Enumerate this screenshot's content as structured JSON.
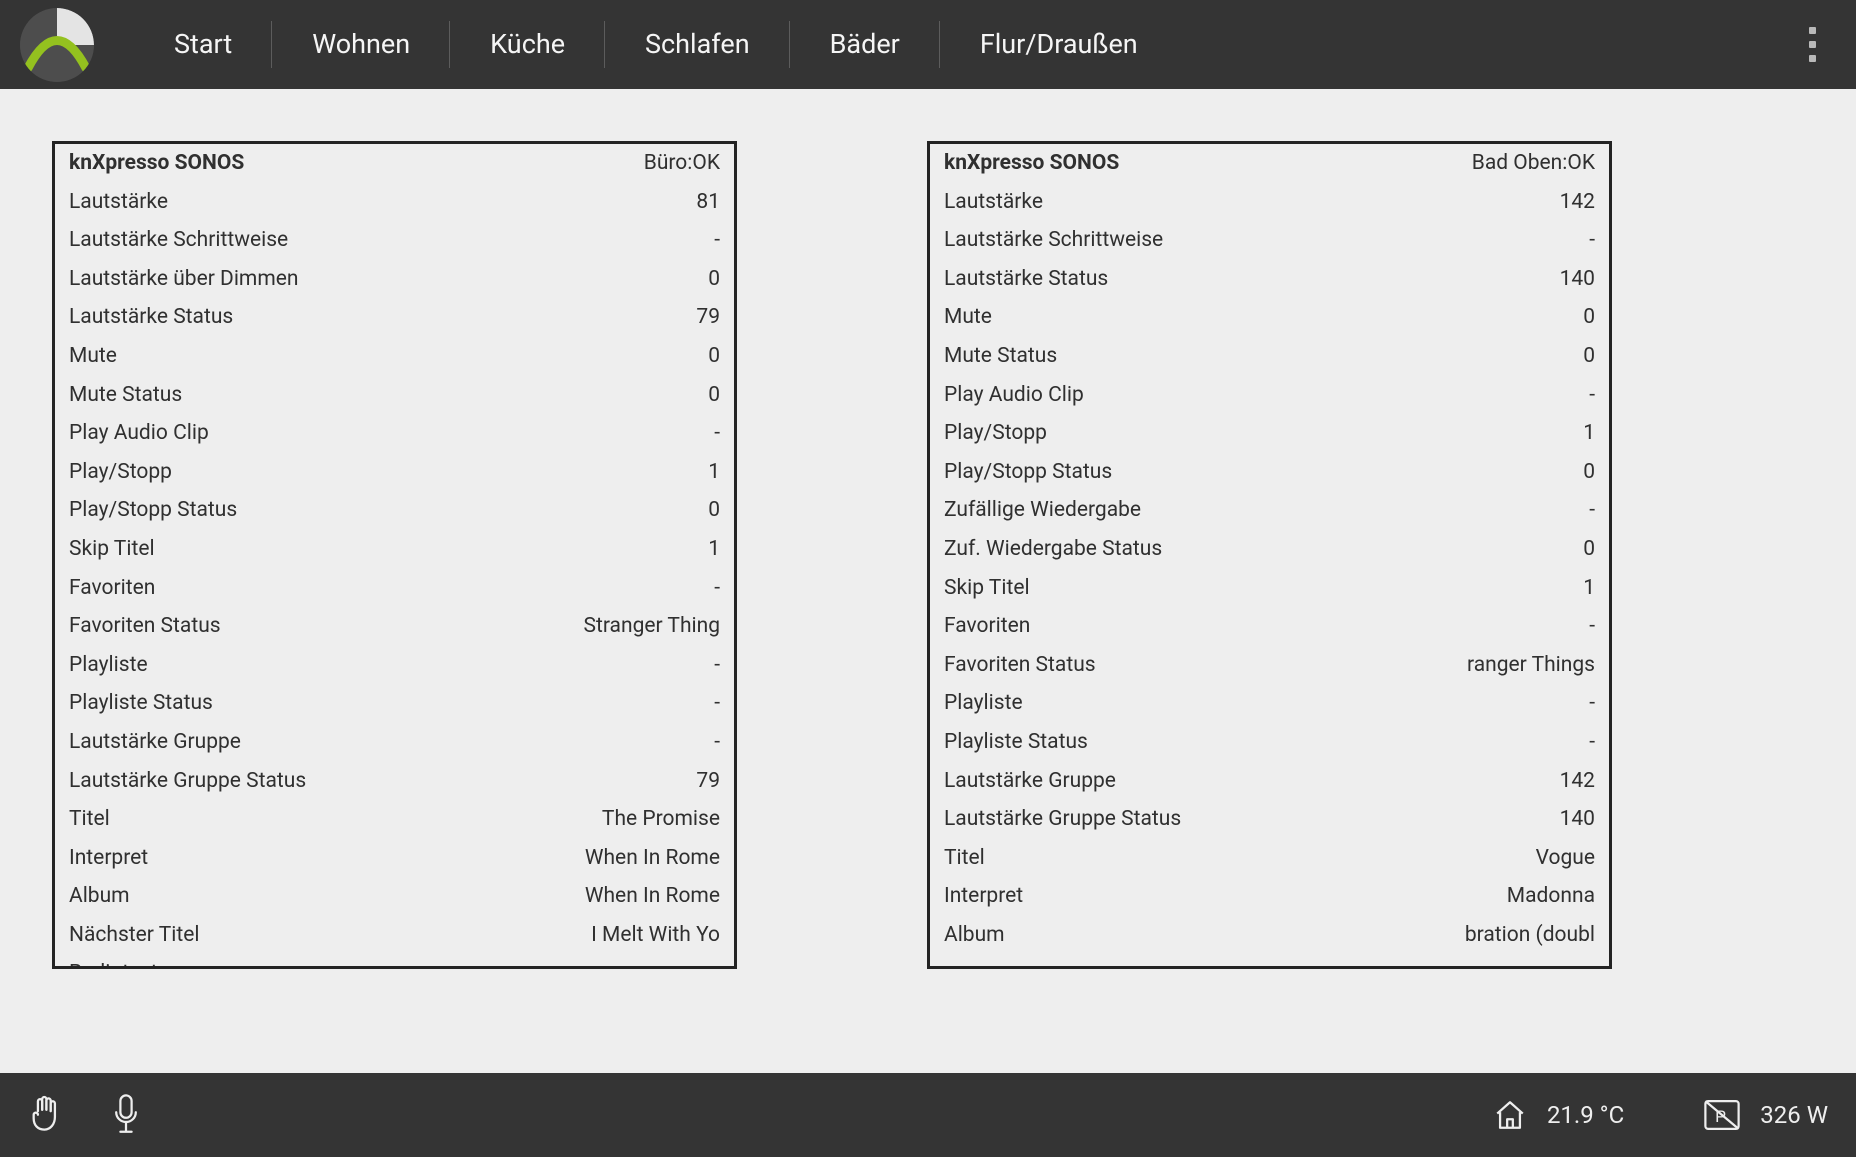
{
  "nav": {
    "items": [
      "Start",
      "Wohnen",
      "Küche",
      "Schlafen",
      "Bäder",
      "Flur/Draußen"
    ]
  },
  "panels": {
    "left": {
      "title": "knXpresso SONOS",
      "status": "Büro:OK",
      "rows": [
        {
          "label": "Lautstärke",
          "value": "81"
        },
        {
          "label": "Lautstärke Schrittweise",
          "value": "-"
        },
        {
          "label": "Lautstärke über Dimmen",
          "value": "0"
        },
        {
          "label": "Lautstärke Status",
          "value": "79"
        },
        {
          "label": "Mute",
          "value": "0"
        },
        {
          "label": "Mute Status",
          "value": "0"
        },
        {
          "label": "Play Audio Clip",
          "value": "-"
        },
        {
          "label": "Play/Stopp",
          "value": "1"
        },
        {
          "label": "Play/Stopp Status",
          "value": "0"
        },
        {
          "label": "Skip Titel",
          "value": "1"
        },
        {
          "label": "Favoriten",
          "value": "-"
        },
        {
          "label": "Favoriten Status",
          "value": "Stranger Thing"
        },
        {
          "label": "Playliste",
          "value": "-"
        },
        {
          "label": "Playliste Status",
          "value": "-"
        },
        {
          "label": "Lautstärke Gruppe",
          "value": "-"
        },
        {
          "label": "Lautstärke Gruppe Status",
          "value": "79"
        },
        {
          "label": "Titel",
          "value": "The Promise"
        },
        {
          "label": "Interpret",
          "value": "When In Rome"
        },
        {
          "label": "Album",
          "value": "When In Rome"
        },
        {
          "label": "Nächster Titel",
          "value": "I Melt With Yo"
        },
        {
          "label": "Radiotext",
          "value": ""
        }
      ]
    },
    "right": {
      "title": "knXpresso SONOS",
      "status": "Bad Oben:OK",
      "rows": [
        {
          "label": "Lautstärke",
          "value": "142"
        },
        {
          "label": "Lautstärke Schrittweise",
          "value": "-"
        },
        {
          "label": "Lautstärke Status",
          "value": "140"
        },
        {
          "label": "Mute",
          "value": "0"
        },
        {
          "label": "Mute Status",
          "value": "0"
        },
        {
          "label": "Play Audio Clip",
          "value": "-"
        },
        {
          "label": "Play/Stopp",
          "value": "1"
        },
        {
          "label": "Play/Stopp Status",
          "value": "0"
        },
        {
          "label": "Zufällige Wiedergabe",
          "value": "-"
        },
        {
          "label": "Zuf. Wiedergabe Status",
          "value": "0"
        },
        {
          "label": "Skip Titel",
          "value": "1"
        },
        {
          "label": "Favoriten",
          "value": "-"
        },
        {
          "label": "Favoriten Status",
          "value": "ranger Things"
        },
        {
          "label": "Playliste",
          "value": "-"
        },
        {
          "label": "Playliste Status",
          "value": "-"
        },
        {
          "label": "Lautstärke Gruppe",
          "value": "142"
        },
        {
          "label": "Lautstärke Gruppe Status",
          "value": "140"
        },
        {
          "label": "Titel",
          "value": "Vogue"
        },
        {
          "label": "Interpret",
          "value": "Madonna"
        },
        {
          "label": "Album",
          "value": "bration (doubl"
        }
      ]
    }
  },
  "footer": {
    "temperature": "21.9 °C",
    "power": "326 W"
  }
}
